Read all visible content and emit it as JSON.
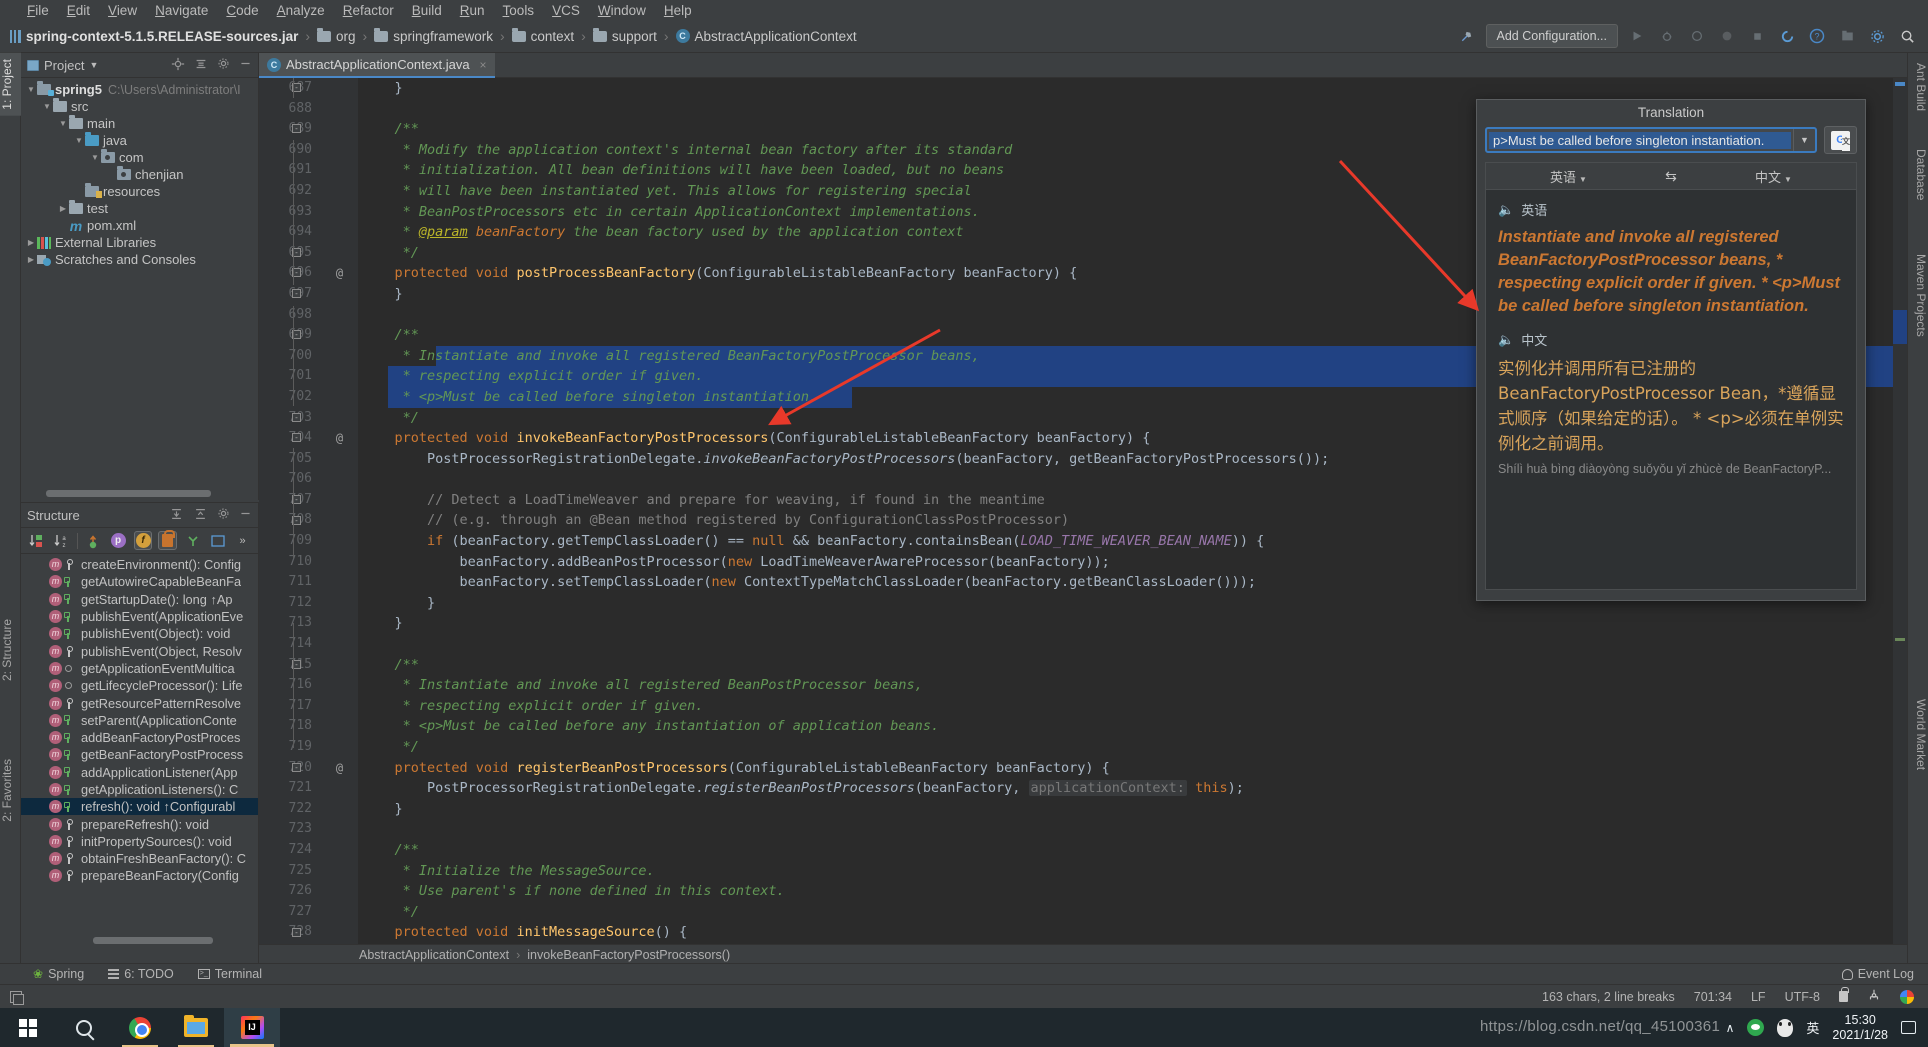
{
  "menubar": [
    "File",
    "Edit",
    "View",
    "Navigate",
    "Code",
    "Analyze",
    "Refactor",
    "Build",
    "Run",
    "Tools",
    "VCS",
    "Window",
    "Help"
  ],
  "toolbar": {
    "breadcrumb": [
      {
        "icon": "jar-icon",
        "label": "spring-context-5.1.5.RELEASE-sources.jar"
      },
      {
        "icon": "folder-icon",
        "label": "org"
      },
      {
        "icon": "folder-icon",
        "label": "springframework"
      },
      {
        "icon": "folder-icon",
        "label": "context"
      },
      {
        "icon": "folder-icon",
        "label": "support"
      },
      {
        "icon": "class-icon",
        "label": "AbstractApplicationContext"
      }
    ],
    "add_configuration": "Add Configuration..."
  },
  "left_strips": [
    {
      "label": "1: Project",
      "selected": true
    },
    {
      "label": "2: Structure",
      "selected": false
    },
    {
      "label": "2: Favorites",
      "selected": false
    }
  ],
  "right_strips": [
    "Ant Build",
    "Database",
    "Maven Projects",
    "World Market"
  ],
  "project_panel": {
    "title": "Project",
    "tree": [
      {
        "depth": 0,
        "arrow": "▼",
        "icon": "module-folder-icon",
        "label": "spring5",
        "sub": "C:\\Users\\Administrator\\I",
        "bold": true
      },
      {
        "depth": 1,
        "arrow": "▼",
        "icon": "folder-icon",
        "label": "src",
        "sub": "",
        "bold": false
      },
      {
        "depth": 2,
        "arrow": "▼",
        "icon": "folder-icon",
        "label": "main",
        "sub": "",
        "bold": false
      },
      {
        "depth": 3,
        "arrow": "▼",
        "icon": "source-folder-icon",
        "label": "java",
        "sub": "",
        "bold": false
      },
      {
        "depth": 4,
        "arrow": "▼",
        "icon": "package-icon",
        "label": "com",
        "sub": "",
        "bold": false
      },
      {
        "depth": 5,
        "arrow": "",
        "icon": "package-icon",
        "label": "chenjian",
        "sub": "",
        "bold": false
      },
      {
        "depth": 3,
        "arrow": "",
        "icon": "resources-folder-icon",
        "label": "resources",
        "sub": "",
        "bold": false
      },
      {
        "depth": 2,
        "arrow": "▶",
        "icon": "folder-icon",
        "label": "test",
        "sub": "",
        "bold": false
      },
      {
        "depth": 2,
        "arrow": "",
        "icon": "maven-icon",
        "label": "pom.xml",
        "sub": "",
        "bold": false
      },
      {
        "depth": 0,
        "arrow": "▶",
        "icon": "library-icon",
        "label": "External Libraries",
        "sub": "",
        "bold": false
      },
      {
        "depth": 0,
        "arrow": "▶",
        "icon": "scratches-icon",
        "label": "Scratches and Consoles",
        "sub": "",
        "bold": false
      }
    ]
  },
  "structure_panel": {
    "title": "Structure",
    "items": [
      {
        "vis": "prot",
        "text": "createEnvironment(): Config",
        "selected": false
      },
      {
        "vis": "pub",
        "text": "getAutowireCapableBeanFa",
        "selected": false
      },
      {
        "vis": "pub",
        "text": "getStartupDate(): long ↑Ap",
        "selected": false
      },
      {
        "vis": "pub",
        "text": "publishEvent(ApplicationEve",
        "selected": false
      },
      {
        "vis": "pub",
        "text": "publishEvent(Object): void",
        "selected": false
      },
      {
        "vis": "prot",
        "text": "publishEvent(Object, Resolv",
        "selected": false
      },
      {
        "vis": "pkg",
        "text": "getApplicationEventMultica",
        "selected": false
      },
      {
        "vis": "pkg",
        "text": "getLifecycleProcessor(): Life",
        "selected": false
      },
      {
        "vis": "prot",
        "text": "getResourcePatternResolve",
        "selected": false
      },
      {
        "vis": "pub",
        "text": "setParent(ApplicationConte",
        "selected": false
      },
      {
        "vis": "pub",
        "text": "addBeanFactoryPostProces",
        "selected": false
      },
      {
        "vis": "pub",
        "text": "getBeanFactoryPostProcess",
        "selected": false
      },
      {
        "vis": "pub",
        "text": "addApplicationListener(App",
        "selected": false
      },
      {
        "vis": "pub",
        "text": "getApplicationListeners(): C",
        "selected": false
      },
      {
        "vis": "pub",
        "text": "refresh(): void ↑Configurabl",
        "selected": true
      },
      {
        "vis": "prot",
        "text": "prepareRefresh(): void",
        "selected": false
      },
      {
        "vis": "prot",
        "text": "initPropertySources(): void",
        "selected": false
      },
      {
        "vis": "prot",
        "text": "obtainFreshBeanFactory(): C",
        "selected": false
      },
      {
        "vis": "prot",
        "text": "prepareBeanFactory(Config",
        "selected": false
      }
    ]
  },
  "editor": {
    "tab": "AbstractApplicationContext.java",
    "first_line": 687,
    "lines": [
      {
        "n": 687,
        "anno": "",
        "sel": false,
        "html": "    }"
      },
      {
        "n": 688,
        "anno": "",
        "sel": false,
        "html": ""
      },
      {
        "n": 689,
        "anno": "",
        "sel": false,
        "html": "    <span class='c-cmt'>/**</span>"
      },
      {
        "n": 690,
        "anno": "",
        "sel": false,
        "html": "     <span class='c-cmt'>* Modify the application context's internal bean factory after its standard</span>"
      },
      {
        "n": 691,
        "anno": "",
        "sel": false,
        "html": "     <span class='c-cmt'>* initialization. All bean definitions will have been loaded, but no beans</span>"
      },
      {
        "n": 692,
        "anno": "",
        "sel": false,
        "html": "     <span class='c-cmt'>* will have been instantiated yet. This allows for registering special</span>"
      },
      {
        "n": 693,
        "anno": "",
        "sel": false,
        "html": "     <span class='c-cmt'>* BeanPostProcessors etc in certain ApplicationContext implementations.</span>"
      },
      {
        "n": 694,
        "anno": "",
        "sel": false,
        "html": "     <span class='c-cmt'>* </span><span class='c-param' style='text-decoration:underline'>@param</span><span class='c-cmt'> </span><span style='color:#cc7832;font-style:italic'>beanFactory</span><span class='c-cmt'> the bean factory used by the application context</span>"
      },
      {
        "n": 695,
        "anno": "",
        "sel": false,
        "html": "     <span class='c-cmt'>*/</span>"
      },
      {
        "n": 696,
        "anno": "@",
        "sel": false,
        "html": "    <span class='c-kw'>protected void </span><span class='c-meth'>postProcessBeanFactory</span>(ConfigurableListableBeanFactory beanFactory) {"
      },
      {
        "n": 697,
        "anno": "",
        "sel": false,
        "html": "    }"
      },
      {
        "n": 698,
        "anno": "",
        "sel": false,
        "html": ""
      },
      {
        "n": 699,
        "anno": "",
        "sel": false,
        "html": "    <span class='c-cmt'>/**</span>"
      },
      {
        "n": 700,
        "anno": "",
        "sel": "part",
        "html": "     <span class='c-cmt'>* </span><span class='c-cmt sel-span'>Instantiate and invoke all registered BeanFactoryPostProcessor beans,</span>"
      },
      {
        "n": 701,
        "anno": "",
        "sel": true,
        "html": "     <span class='c-cmt'>* respecting explicit order if given.</span>"
      },
      {
        "n": 702,
        "anno": "",
        "sel": "part2",
        "html": "     <span class='c-cmt'>* &lt;p&gt;Must be called before singleton instantiation.</span>"
      },
      {
        "n": 703,
        "anno": "",
        "sel": false,
        "html": "     <span class='c-cmt'>*/</span>"
      },
      {
        "n": 704,
        "anno": "@",
        "sel": false,
        "html": "    <span class='c-kw'>protected void </span><span class='c-meth'>invokeBeanFactoryPostProcessors</span>(ConfigurableListableBeanFactory beanFactory) {"
      },
      {
        "n": 705,
        "anno": "",
        "sel": false,
        "html": "        PostProcessorRegistrationDelegate.<span class='c-italic'>invokeBeanFactoryPostProcessors</span>(beanFactory, getBeanFactoryPostProcessors());"
      },
      {
        "n": 706,
        "anno": "",
        "sel": false,
        "html": ""
      },
      {
        "n": 707,
        "anno": "",
        "sel": false,
        "html": "        <span class='c-cmt2'>// Detect a LoadTimeWeaver and prepare for weaving, if found in the meantime</span>"
      },
      {
        "n": 708,
        "anno": "",
        "sel": false,
        "html": "        <span class='c-cmt2'>// (e.g. through an @Bean method registered by ConfigurationClassPostProcessor)</span>"
      },
      {
        "n": 709,
        "anno": "",
        "sel": false,
        "html": "        <span class='c-kw'>if </span>(beanFactory.getTempClassLoader() == <span class='c-kw'>null </span>&amp;&amp; beanFactory.containsBean(<span class='c-const'>LOAD_TIME_WEAVER_BEAN_NAME</span>)) {"
      },
      {
        "n": 710,
        "anno": "",
        "sel": false,
        "html": "            beanFactory.addBeanPostProcessor(<span class='c-kw'>new </span>LoadTimeWeaverAwareProcessor(beanFactory));"
      },
      {
        "n": 711,
        "anno": "",
        "sel": false,
        "html": "            beanFactory.setTempClassLoader(<span class='c-kw'>new </span>ContextTypeMatchClassLoader(beanFactory.getBeanClassLoader()));"
      },
      {
        "n": 712,
        "anno": "",
        "sel": false,
        "html": "        }"
      },
      {
        "n": 713,
        "anno": "",
        "sel": false,
        "html": "    }"
      },
      {
        "n": 714,
        "anno": "",
        "sel": false,
        "html": ""
      },
      {
        "n": 715,
        "anno": "",
        "sel": false,
        "html": "    <span class='c-cmt'>/**</span>"
      },
      {
        "n": 716,
        "anno": "",
        "sel": false,
        "html": "     <span class='c-cmt'>* Instantiate and invoke all registered BeanPostProcessor beans,</span>"
      },
      {
        "n": 717,
        "anno": "",
        "sel": false,
        "html": "     <span class='c-cmt'>* respecting explicit order if given.</span>"
      },
      {
        "n": 718,
        "anno": "",
        "sel": false,
        "html": "     <span class='c-cmt'>* &lt;p&gt;Must be called before any instantiation of application beans.</span>"
      },
      {
        "n": 719,
        "anno": "",
        "sel": false,
        "html": "     <span class='c-cmt'>*/</span>"
      },
      {
        "n": 720,
        "anno": "@",
        "sel": false,
        "html": "    <span class='c-kw'>protected void </span><span class='c-meth'>registerBeanPostProcessors</span>(ConfigurableListableBeanFactory beanFactory) {"
      },
      {
        "n": 721,
        "anno": "",
        "sel": false,
        "html": "        PostProcessorRegistrationDelegate.<span class='c-italic'>registerBeanPostProcessors</span>(beanFactory, <span class='c-hint'>applicationContext:</span> <span class='c-kw'>this</span>);"
      },
      {
        "n": 722,
        "anno": "",
        "sel": false,
        "html": "    }"
      },
      {
        "n": 723,
        "anno": "",
        "sel": false,
        "html": ""
      },
      {
        "n": 724,
        "anno": "",
        "sel": false,
        "html": "    <span class='c-cmt'>/**</span>"
      },
      {
        "n": 725,
        "anno": "",
        "sel": false,
        "html": "     <span class='c-cmt'>* Initialize the MessageSource.</span>"
      },
      {
        "n": 726,
        "anno": "",
        "sel": false,
        "html": "     <span class='c-cmt'>* Use parent's if none defined in this context.</span>"
      },
      {
        "n": 727,
        "anno": "",
        "sel": false,
        "html": "     <span class='c-cmt'>*/</span>"
      },
      {
        "n": 728,
        "anno": "",
        "sel": false,
        "html": "    <span class='c-kw'>protected void </span><span class='c-meth'>initMessageSource</span>() {"
      }
    ],
    "breadcrumb": [
      "AbstractApplicationContext",
      "invokeBeanFactoryPostProcessors()"
    ]
  },
  "translation": {
    "title": "Translation",
    "query": "p>Must be called before singleton instantiation.",
    "source_lang": "英语",
    "target_lang": "中文",
    "swap_icon": "swap-icon",
    "google_icon": "google-translate-icon",
    "source_label": "英语",
    "source_text": "Instantiate and invoke all registered BeanFactoryPostProcessor beans, * respecting explicit order if given. * <p>Must be called before singleton instantiation.",
    "target_label": "中文",
    "target_text": "实例化并调用所有已注册的BeanFactoryPostProcessor Bean，*遵循显式顺序（如果给定的话）。 * <p>必须在单例实例化之前调用。",
    "pinyin": "Shílì huà bìng diàoyòng suǒyǒu yǐ zhùcè de BeanFactoryP..."
  },
  "bottom_tools": [
    {
      "icon": "spring-leaf-icon",
      "label": "Spring"
    },
    {
      "icon": "todo-list-icon",
      "label": "6: TODO"
    },
    {
      "icon": "terminal-icon",
      "label": "Terminal"
    }
  ],
  "event_log": "Event Log",
  "statusbar": {
    "chars": "163 chars, 2 line breaks",
    "caret": "701:34",
    "line_sep": "LF",
    "encoding": "UTF-8",
    "lock_icon": "lock-icon",
    "vcs_icon": "vcs-icon",
    "google_icon": "google-icon"
  },
  "taskbar": {
    "items": [
      {
        "icon": "windows-start-icon",
        "name": "start-button"
      },
      {
        "icon": "search-icon",
        "name": "taskbar-search"
      },
      {
        "icon": "chrome-icon",
        "name": "taskbar-chrome"
      },
      {
        "icon": "explorer-icon",
        "name": "taskbar-explorer"
      },
      {
        "icon": "intellij-icon",
        "name": "taskbar-intellij"
      }
    ],
    "tray_caret": "∧",
    "ime": "英",
    "time": "15:30",
    "date": "2021/1/28",
    "watermark": "https://blog.csdn.net/qq_45100361"
  },
  "colors": {
    "accent_blue": "#4a88c7",
    "selection": "#214283",
    "comment_green": "#629755",
    "keyword_orange": "#cc7832",
    "method_yellow": "#ffc66d",
    "arrow_red": "#e8392a",
    "translation_orange": "#cc7832",
    "translation_gold": "#d9a45b"
  }
}
